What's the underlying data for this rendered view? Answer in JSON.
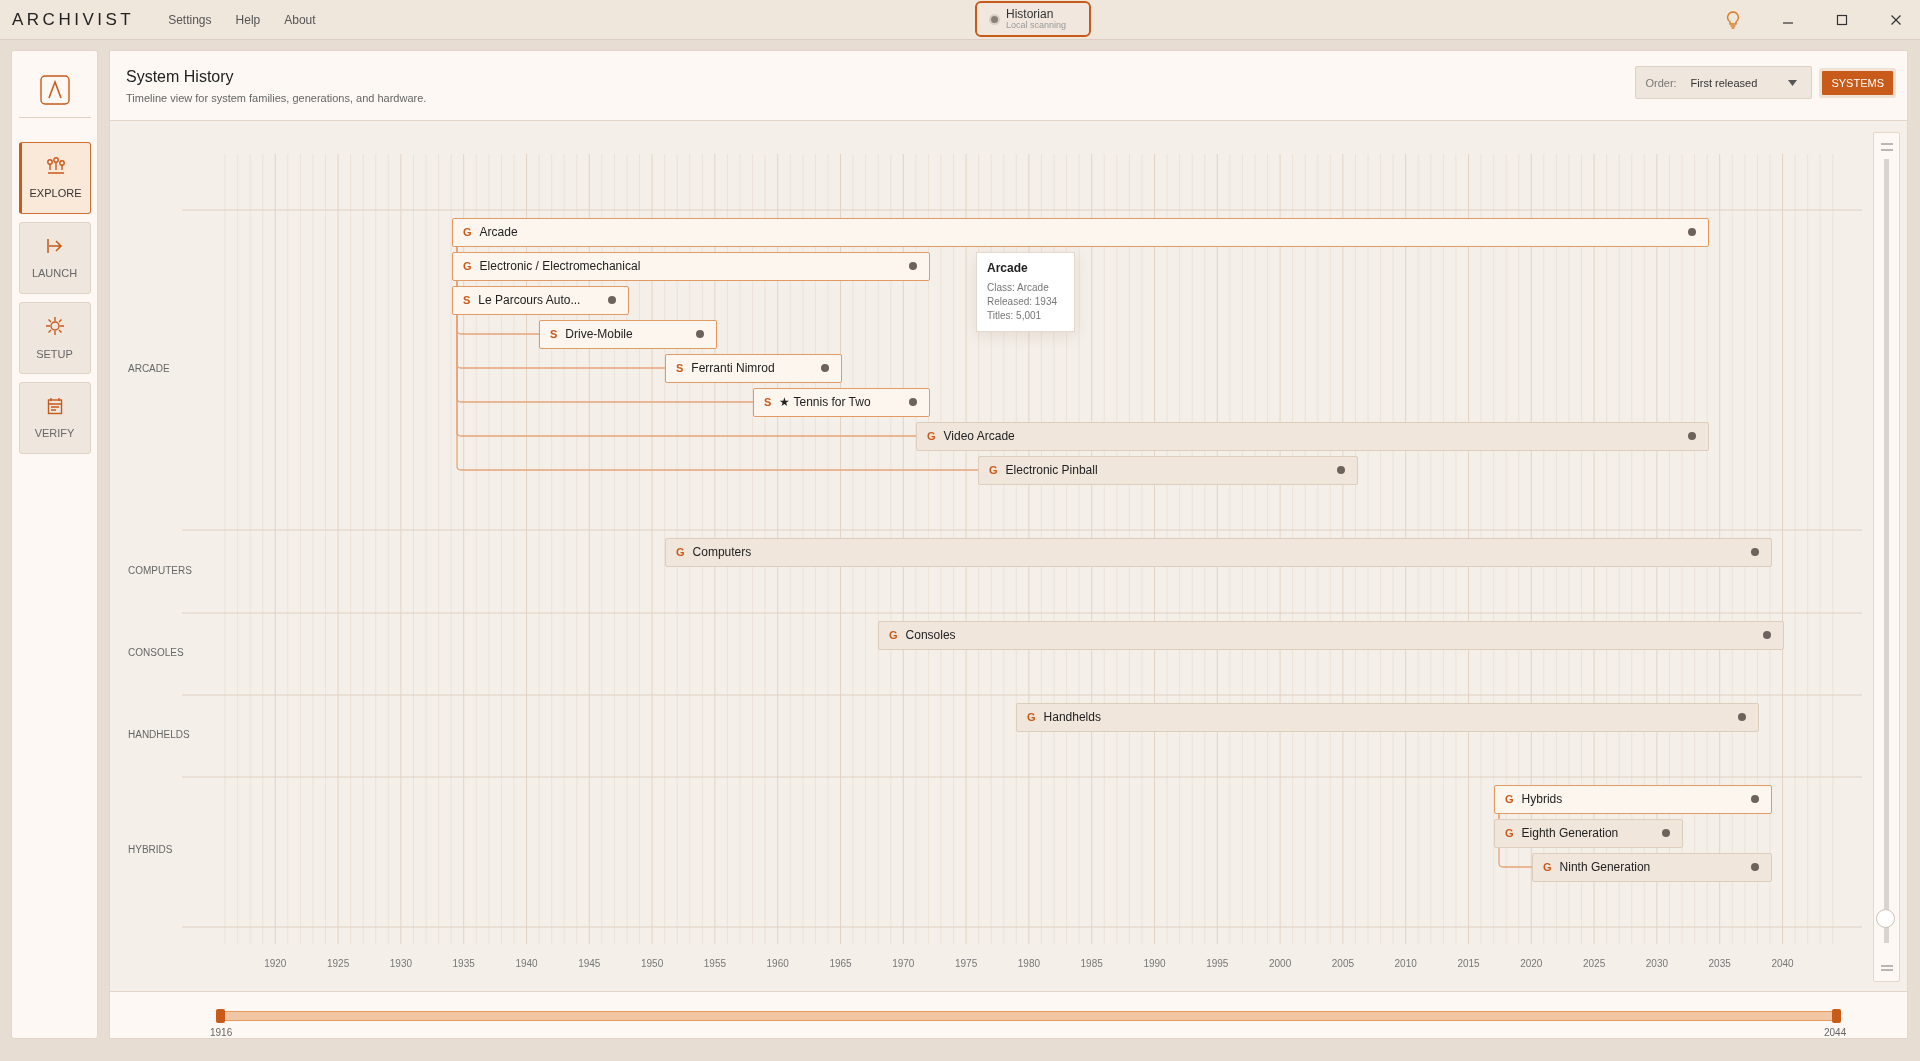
{
  "app": {
    "name": "ARCHIVIST"
  },
  "menu": [
    "Settings",
    "Help",
    "About"
  ],
  "status_chip": {
    "title": "Historian",
    "subtitle": "Local scanning"
  },
  "sidebar": {
    "items": [
      {
        "label": "EXPLORE",
        "kind": "explore",
        "selected": true
      },
      {
        "label": "LAUNCH",
        "kind": "launch",
        "selected": false
      },
      {
        "label": "SETUP",
        "kind": "setup",
        "selected": false
      },
      {
        "label": "VERIFY",
        "kind": "verify",
        "selected": false
      }
    ]
  },
  "header": {
    "title": "System History",
    "subtitle": "Timeline view for system families, generations, and hardware.",
    "order_label": "Order:",
    "order_value": "First released",
    "systems_button": "SYSTEMS"
  },
  "groups": [
    {
      "label": "ARCADE",
      "entries": [
        {
          "badge": "G",
          "label": "Arcade",
          "highlighted": true,
          "children": [
            {
              "badge": "G",
              "label": "Electronic / Electromechanical",
              "highlighted": true
            },
            {
              "badge": "S",
              "label": "Le Parcours Auto...",
              "highlighted": true
            },
            {
              "badge": "S",
              "label": "Drive-Mobile",
              "highlighted": true
            },
            {
              "badge": "S",
              "label": "Ferranti Nimrod",
              "highlighted": true
            },
            {
              "badge": "S",
              "label": "★ Tennis for Two",
              "highlighted": true
            },
            {
              "badge": "G",
              "label": "Video Arcade",
              "highlighted": false
            },
            {
              "badge": "G",
              "label": "Electronic Pinball",
              "highlighted": false
            }
          ]
        }
      ]
    },
    {
      "label": "COMPUTERS",
      "entries": [
        {
          "badge": "G",
          "label": "Computers",
          "highlighted": false
        }
      ]
    },
    {
      "label": "CONSOLES",
      "entries": [
        {
          "badge": "G",
          "label": "Consoles",
          "highlighted": false
        }
      ]
    },
    {
      "label": "HANDHELDS",
      "entries": [
        {
          "badge": "G",
          "label": "Handhelds",
          "highlighted": false
        }
      ]
    },
    {
      "label": "HYBRIDS",
      "entries": [
        {
          "badge": "G",
          "label": "Hybrids",
          "highlighted": true,
          "children": [
            {
              "badge": "G",
              "label": "Eighth Generation",
              "highlighted": false
            },
            {
              "badge": "G",
              "label": "Ninth Generation",
              "highlighted": false
            }
          ]
        }
      ]
    }
  ],
  "tooltip": {
    "title": "Arcade",
    "lines": [
      "Class: Arcade",
      "Released: 1934",
      "Titles: 5,001"
    ]
  },
  "axis_years": [
    "1920",
    "1925",
    "1930",
    "1935",
    "1940",
    "1945",
    "1950",
    "1955",
    "1960",
    "1965",
    "1970",
    "1975",
    "1980",
    "1985",
    "1990",
    "1995",
    "2000",
    "2005",
    "2010",
    "2015",
    "2020",
    "2025",
    "2030",
    "2035",
    "2040"
  ],
  "zoom": {
    "level": 0.03
  },
  "range": {
    "from": "1916",
    "to": "2044"
  }
}
